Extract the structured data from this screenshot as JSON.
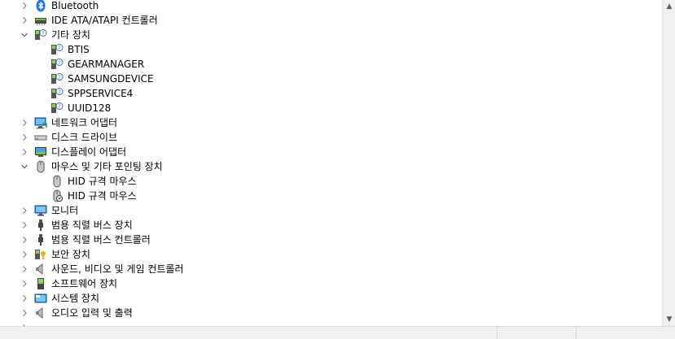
{
  "tree": {
    "items": [
      {
        "label": "Bluetooth",
        "icon": "bluetooth-icon",
        "level": 0,
        "expander": "collapsed"
      },
      {
        "label": "IDE ATA/ATAPI 컨트롤러",
        "icon": "ide-controller-icon",
        "level": 0,
        "expander": "collapsed"
      },
      {
        "label": "기타 장치",
        "icon": "unknown-device-icon",
        "level": 0,
        "expander": "expanded"
      },
      {
        "label": "BTIS",
        "icon": "unknown-device-icon",
        "level": 1,
        "expander": "none"
      },
      {
        "label": "GEARMANAGER",
        "icon": "unknown-device-icon",
        "level": 1,
        "expander": "none"
      },
      {
        "label": "SAMSUNGDEVICE",
        "icon": "unknown-device-icon",
        "level": 1,
        "expander": "none"
      },
      {
        "label": "SPPSERVICE4",
        "icon": "unknown-device-icon",
        "level": 1,
        "expander": "none"
      },
      {
        "label": "UUID128",
        "icon": "unknown-device-icon",
        "level": 1,
        "expander": "none"
      },
      {
        "label": "네트워크 어댑터",
        "icon": "network-adapter-icon",
        "level": 0,
        "expander": "collapsed"
      },
      {
        "label": "디스크 드라이브",
        "icon": "disk-drive-icon",
        "level": 0,
        "expander": "collapsed"
      },
      {
        "label": "디스플레이 어댑터",
        "icon": "display-adapter-icon",
        "level": 0,
        "expander": "collapsed"
      },
      {
        "label": "마우스 및 기타 포인팅 장치",
        "icon": "mouse-icon",
        "level": 0,
        "expander": "expanded"
      },
      {
        "label": "HID 규격 마우스",
        "icon": "mouse-icon",
        "level": 1,
        "expander": "none"
      },
      {
        "label": "HID 규격 마우스",
        "icon": "mouse-warning-icon",
        "level": 1,
        "expander": "none"
      },
      {
        "label": "모니터",
        "icon": "monitor-icon",
        "level": 0,
        "expander": "collapsed"
      },
      {
        "label": "범용 직렬 버스 장치",
        "icon": "usb-icon",
        "level": 0,
        "expander": "collapsed"
      },
      {
        "label": "범용 직렬 버스 컨트롤러",
        "icon": "usb-icon",
        "level": 0,
        "expander": "collapsed"
      },
      {
        "label": "보안 장치",
        "icon": "security-device-icon",
        "level": 0,
        "expander": "collapsed"
      },
      {
        "label": "사운드, 비디오 및 게임 컨트롤러",
        "icon": "speaker-icon",
        "level": 0,
        "expander": "collapsed"
      },
      {
        "label": "소프트웨어 장치",
        "icon": "software-device-icon",
        "level": 0,
        "expander": "collapsed"
      },
      {
        "label": "시스템 장치",
        "icon": "system-device-icon",
        "level": 0,
        "expander": "collapsed"
      },
      {
        "label": "오디오 입력 및 출력",
        "icon": "speaker-icon",
        "level": 0,
        "expander": "collapsed"
      },
      {
        "label": "",
        "icon": "",
        "level": 0,
        "expander": "collapsed"
      }
    ]
  },
  "scrollbars": {
    "vertical": {
      "up": "scroll-up-arrow",
      "down": "scroll-down-arrow"
    }
  }
}
